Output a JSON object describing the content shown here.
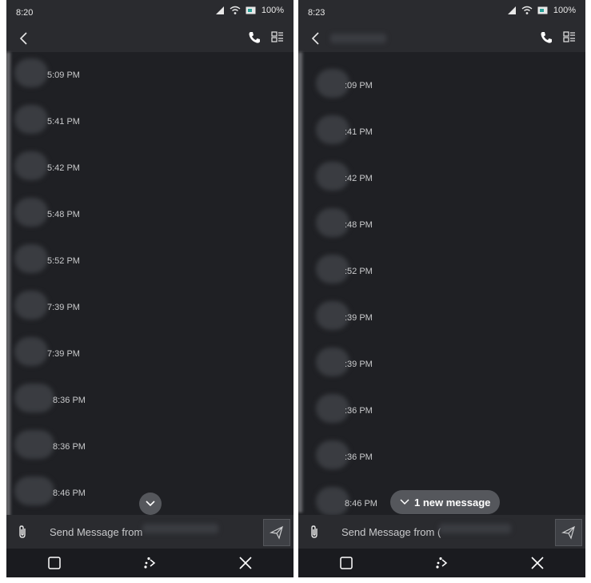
{
  "screens": [
    {
      "status_time": "8:20",
      "battery": "100%",
      "timestamps": [
        "5:09 PM",
        "5:41 PM",
        "5:42 PM",
        "5:48 PM",
        "5:52 PM",
        "7:39 PM",
        "7:39 PM",
        "8:36 PM",
        "8:36 PM",
        "8:46 PM"
      ],
      "composer_placeholder": "Send Message from"
    },
    {
      "status_time": "8:23",
      "battery": "100%",
      "timestamps": [
        ":09 PM",
        ":41 PM",
        ":42 PM",
        ":48 PM",
        ":52 PM",
        ":39 PM",
        ":39 PM",
        ":36 PM",
        ":36 PM",
        "8:46 PM"
      ],
      "composer_placeholder": "Send Message from (",
      "new_message_label": "1 new message"
    }
  ],
  "colors": {
    "background": "#1f2024",
    "bar": "#2a2b2f",
    "pill": "#55575c",
    "text": "#c9cacc"
  }
}
